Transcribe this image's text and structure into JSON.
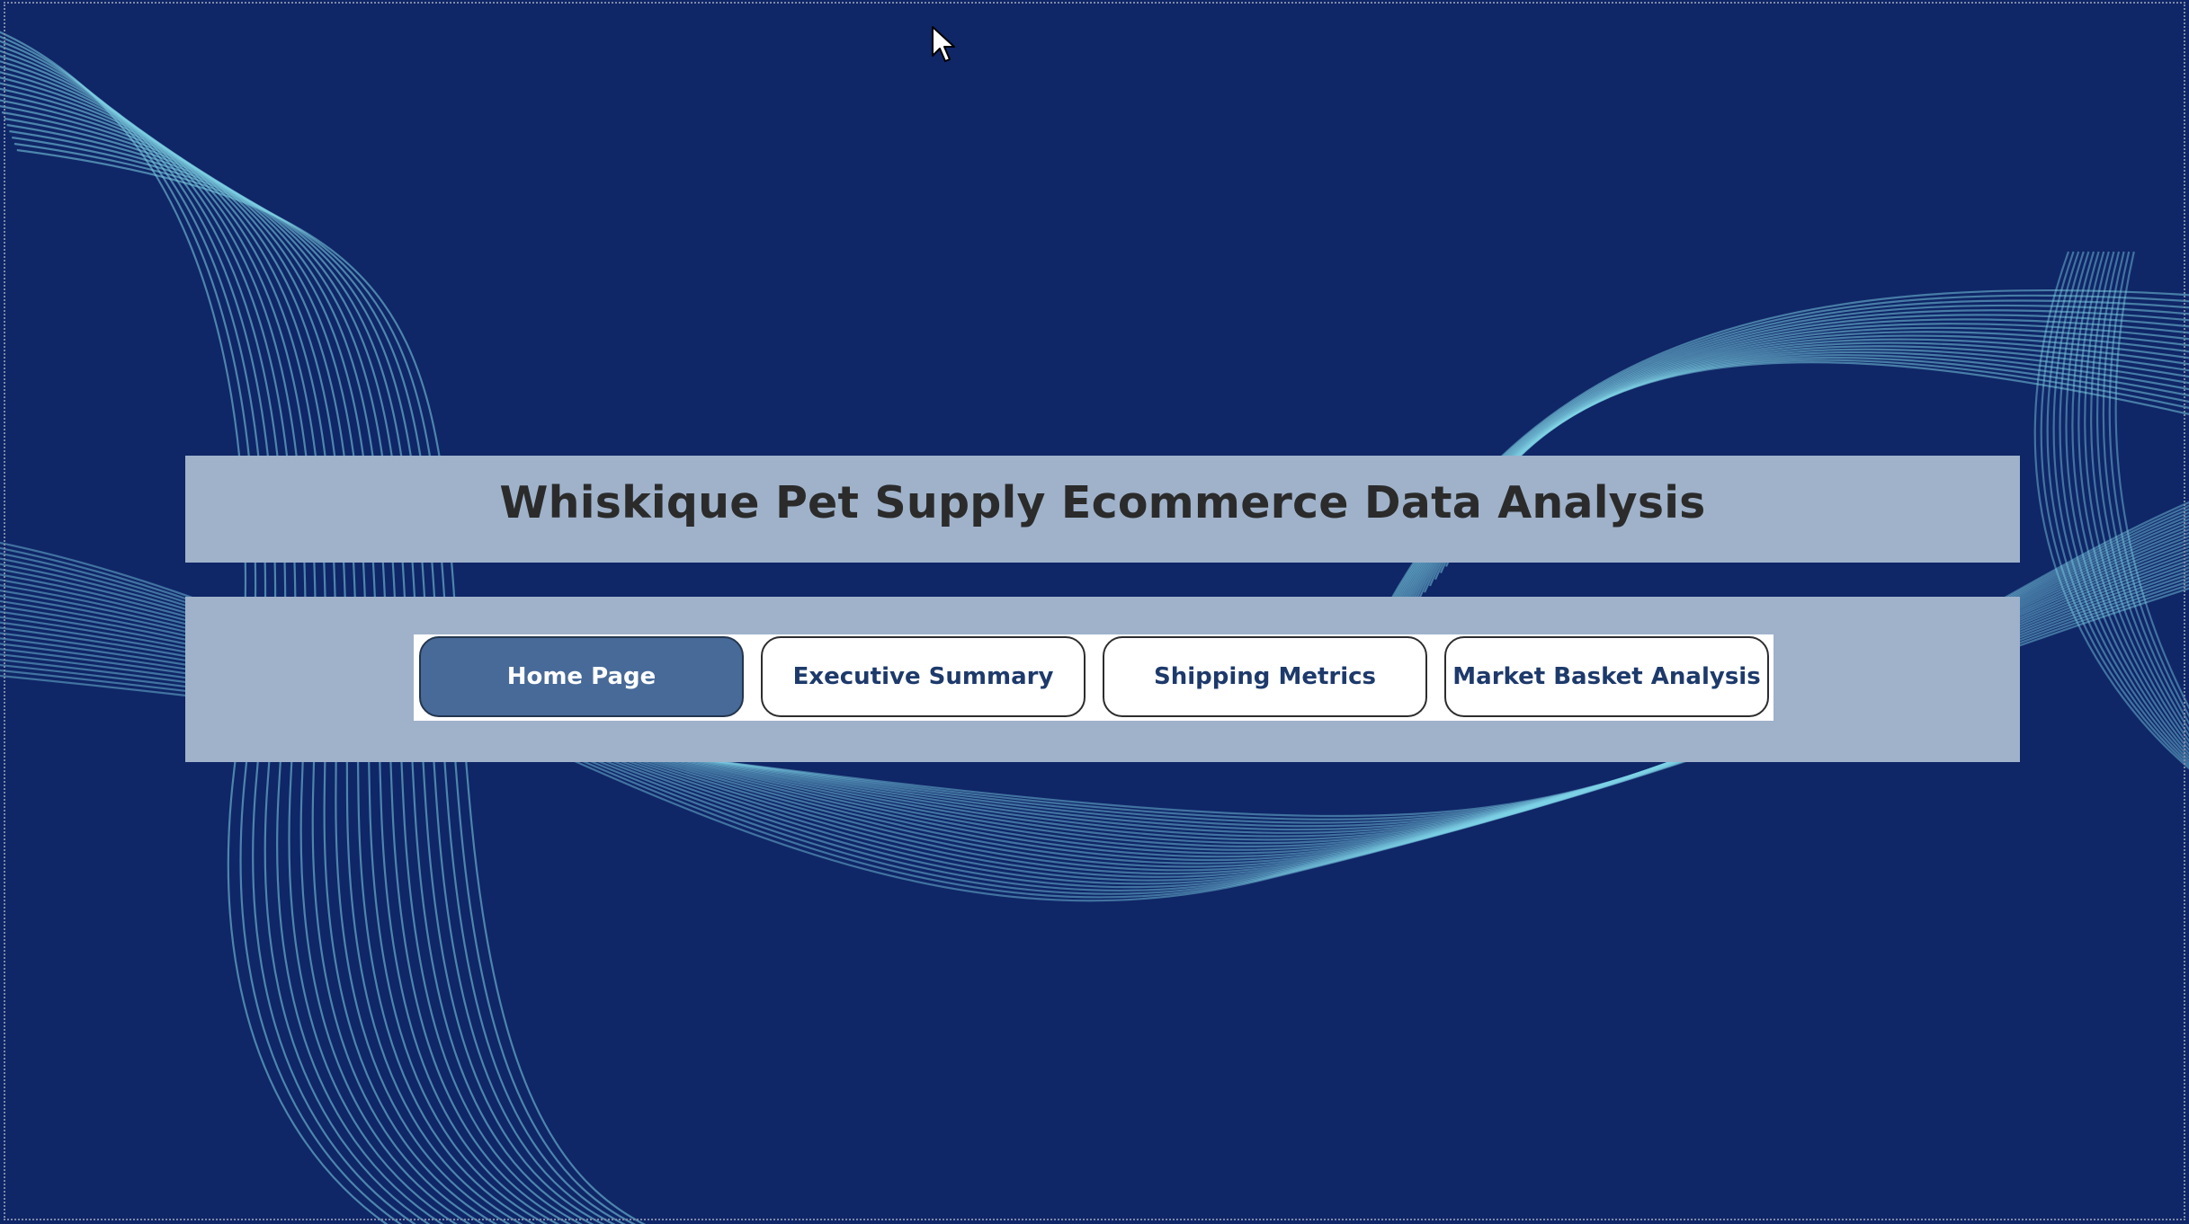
{
  "report": {
    "title": "Whiskique Pet Supply Ecommerce Data Analysis"
  },
  "navigation": {
    "buttons": [
      {
        "label": "Home Page",
        "active": true
      },
      {
        "label": "Executive Summary",
        "active": false
      },
      {
        "label": "Shipping Metrics",
        "active": false
      },
      {
        "label": "Market Basket Analysis",
        "active": false
      }
    ]
  },
  "theme": {
    "background": "#0f2667",
    "banner": "#9fb2ca",
    "active_button": "#476a98",
    "wave_color": "#7fd3e6"
  },
  "icons": {
    "cursor": "mouse-pointer-icon"
  }
}
